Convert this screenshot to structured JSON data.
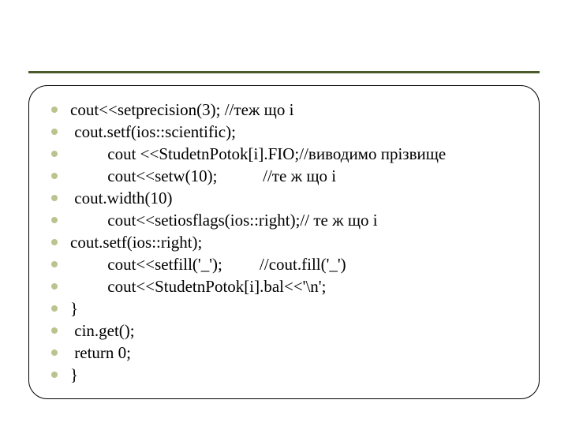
{
  "lines": [
    "cout<<setprecision(3); //теж що і",
    " cout.setf(ios::scientific);",
    "         cout <<StudetnPotok[i].FIO;//виводимо прізвище",
    "         cout<<setw(10);           //те ж що і",
    " cout.width(10)",
    "         cout<<setiosflags(ios::right);// те ж що і",
    "cout.setf(ios::right);",
    "         cout<<setfill('_');         //cout.fill('_')",
    "         cout<<StudetnPotok[i].bal<<'\\n';",
    "}",
    " cin.get();",
    " return 0;",
    "}"
  ]
}
